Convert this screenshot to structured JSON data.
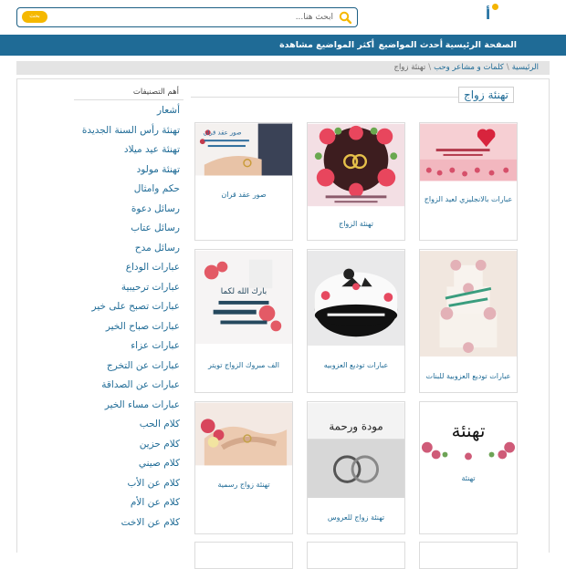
{
  "header": {
    "search_placeholder": "ابحث هنا...",
    "search_button": "بحث"
  },
  "nav": {
    "home": "الصفحة الرئيسية",
    "latest": "أحدث المواضيع",
    "most_viewed": "أكثر المواضيع مشاهدة"
  },
  "breadcrumb": {
    "home": "الرئيسية",
    "category": "كلمات و مشاعر وحب",
    "current": "تهنئة زواج"
  },
  "section_title": "تهنئة زواج",
  "sidebar": {
    "heading": "أهم التصنيفات",
    "items": [
      "أشعار",
      "تهنئة رأس السنة الجديدة",
      "تهنئة عيد ميلاد",
      "تهنئة مولود",
      "حكم وامثال",
      "رسائل دعوة",
      "رسائل عتاب",
      "رسائل مدح",
      "عبارات الوداع",
      "عبارات ترحيبية",
      "عبارات تصبح على خير",
      "عبارات صباح الخير",
      "عبارات عزاء",
      "عبارات عن التخرج",
      "عبارات عن الصداقة",
      "عبارات مساء الخير",
      "كلام الحب",
      "كلام حزين",
      "كلام صيني",
      "كلام عن الأب",
      "كلام عن الأم",
      "كلام عن الاخت"
    ]
  },
  "cards": [
    {
      "caption": "عبارات بالانجليزي لعيد الزواج"
    },
    {
      "caption": "تهنئة الزواج"
    },
    {
      "caption": "صور عقد قران"
    },
    {
      "caption": "عبارات توديع العزوبية للبنات"
    },
    {
      "caption": "عبارات توديع العزوبيه"
    },
    {
      "caption": "الف مبروك الزواج تويتر"
    },
    {
      "caption": "تهنئة"
    },
    {
      "caption": "تهنئة زواج للعروس"
    },
    {
      "caption": "تهنئة زواج رسمية"
    }
  ],
  "image_text": {
    "img3": "صور عقد قران",
    "img6": "بارك الله لكما",
    "img7": "تهنئة",
    "img8": "مودة ورحمة"
  },
  "colors": {
    "brand_blue": "#1f6b96",
    "accent_yellow": "#f5b800"
  }
}
